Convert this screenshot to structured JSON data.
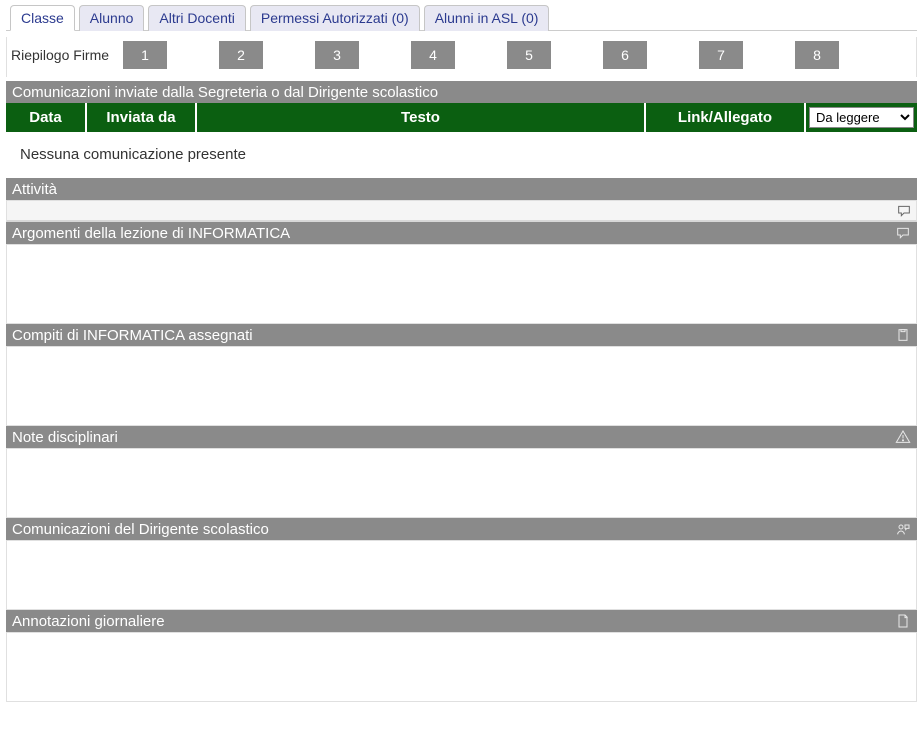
{
  "tabs": [
    "Classe",
    "Alunno",
    "Altri Docenti",
    "Permessi Autorizzati (0)",
    "Alunni in ASL (0)"
  ],
  "active_tab_index": 0,
  "firme": {
    "label": "Riepilogo Firme",
    "slots": [
      "1",
      "2",
      "3",
      "4",
      "5",
      "6",
      "7",
      "8"
    ]
  },
  "communications": {
    "title": "Comunicazioni inviate dalla Segreteria o dal Dirigente scolastico",
    "columns": {
      "data": "Data",
      "inviata": "Inviata da",
      "testo": "Testo",
      "link": "Link/Allegato"
    },
    "status_options": [
      "Da leggere"
    ],
    "status_selected": "Da leggere",
    "empty_text": "Nessuna comunicazione presente"
  },
  "sections": {
    "attivita": "Attività",
    "argomenti": "Argomenti della lezione di INFORMATICA",
    "compiti": "Compiti di INFORMATICA assegnati",
    "note": "Note disciplinari",
    "dirigente": "Comunicazioni del Dirigente scolastico",
    "annotazioni": "Annotazioni giornaliere"
  }
}
